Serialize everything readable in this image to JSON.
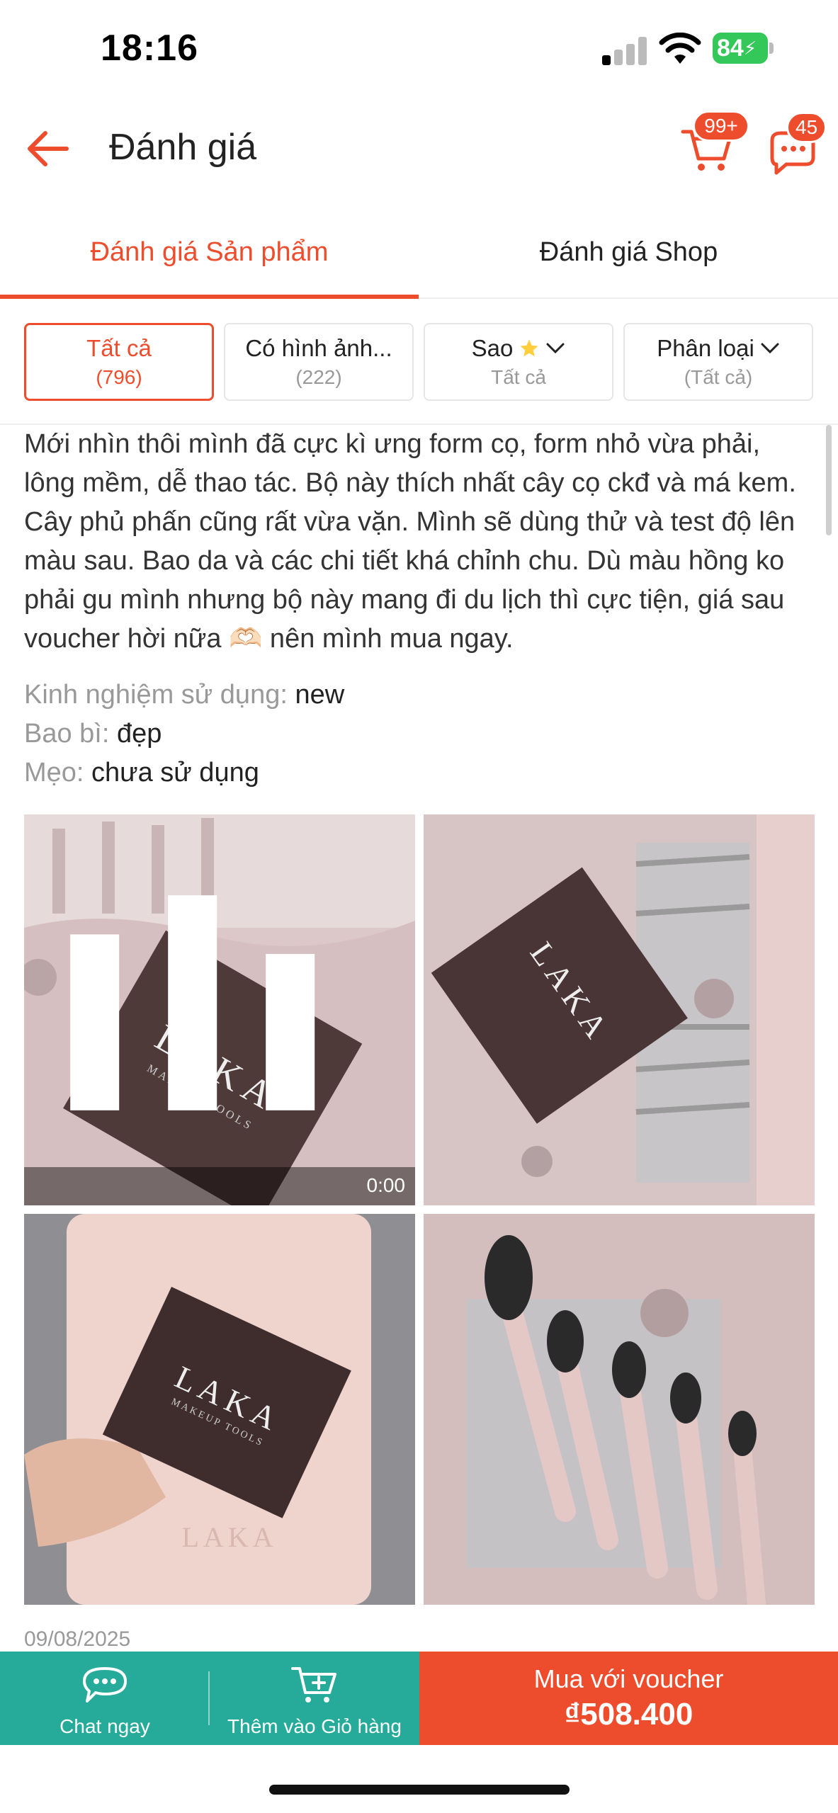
{
  "status_bar": {
    "time": "18:16",
    "battery": "84"
  },
  "header": {
    "title": "Đánh giá",
    "cart_badge": "99+",
    "chat_badge": "45"
  },
  "tabs": [
    {
      "label": "Đánh giá Sản phẩm",
      "active": true
    },
    {
      "label": "Đánh giá Shop",
      "active": false
    }
  ],
  "filters": [
    {
      "label": "Tất cả",
      "sub": "(796)"
    },
    {
      "label": "Có hình ảnh...",
      "sub": "(222)"
    },
    {
      "label": "Sao",
      "sub": "Tất cả"
    },
    {
      "label": "Phân loại",
      "sub": "(Tất cả)"
    }
  ],
  "review": {
    "text": "Mới nhìn thôi mình đã cực kì ưng form cọ, form nhỏ vừa phải, lông mềm, dễ thao tác. Bộ này thích nhất cây cọ ckđ và má kem. Cây phủ phấn cũng rất vừa vặn. Mình sẽ dùng thử và test độ lên màu sau. Bao da và các chi tiết khá chỉnh chu. Dù màu hồng ko phải gu mình nhưng bộ này mang đi du lịch thì cực tiện, giá sau voucher hời nữa 🫶🏻 nên mình mua ngay.",
    "meta": [
      {
        "key": "Kinh nghiệm sử dụng:",
        "value": "new"
      },
      {
        "key": "Bao bì:",
        "value": "đẹp"
      },
      {
        "key": "Mẹo:",
        "value": "chưa sử dụng"
      }
    ],
    "video_time": "0:00",
    "date": "09/08/2025",
    "photo_brand": "LAKA",
    "photo_brand_sub": "MAKEUP TOOLS"
  },
  "bottom_bar": {
    "chat_label": "Chat ngay",
    "cart_label": "Thêm vào Giỏ hàng",
    "buy_label": "Mua với voucher",
    "price": "₫508.400"
  },
  "colors": {
    "accent": "#ee4d2d",
    "teal": "#26aa99"
  }
}
